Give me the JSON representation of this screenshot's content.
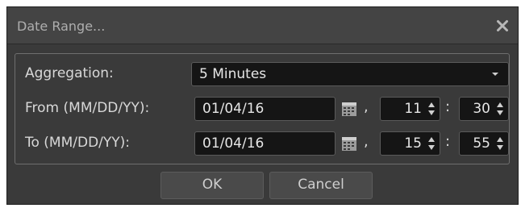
{
  "dialog": {
    "title": "Date Range...",
    "icons": {
      "close": "close-icon",
      "calendar": "calendar-icon",
      "dropdown": "chevron-down-icon",
      "spinner": "spinner-arrows-icon"
    },
    "colors": {
      "background": "#3a3a3a",
      "titlebar": "#444444",
      "field": "#151515",
      "text": "#d8d8d8"
    }
  },
  "aggregation": {
    "label": "Aggregation:",
    "value": "5 Minutes"
  },
  "from": {
    "label": "From (MM/DD/YY):",
    "date": "01/04/16",
    "comma": ",",
    "hour": "11",
    "colon": ":",
    "minute": "30"
  },
  "to": {
    "label": "To (MM/DD/YY):",
    "date": "01/04/16",
    "comma": ",",
    "hour": "15",
    "colon": ":",
    "minute": "55"
  },
  "buttons": {
    "ok": "OK",
    "cancel": "Cancel"
  }
}
